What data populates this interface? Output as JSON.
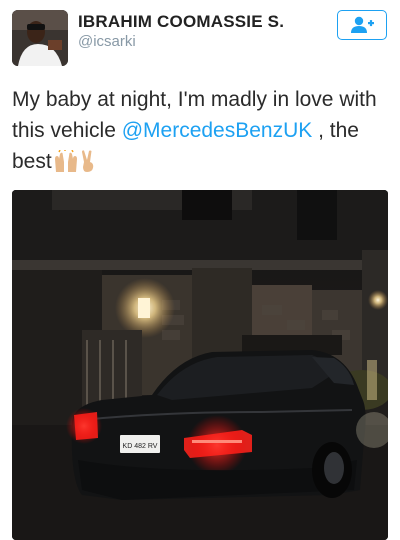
{
  "header": {
    "display_name": "IBRAHIM COOMASSIE S.",
    "handle": "@icsarki",
    "follow_icon": "add-user-icon"
  },
  "tweet": {
    "text_part1": "My baby at night, I'm madly in love with this vehicle ",
    "mention": "@MercedesBenzUK",
    "text_part2": " , the best",
    "emojis": [
      "raising-hands-icon",
      "victory-hand-icon"
    ]
  },
  "photo": {
    "license_plate": "KD 482 RV"
  },
  "colors": {
    "accent": "#1da1f2",
    "handle": "#8899a6",
    "text": "#2b2b2b"
  }
}
